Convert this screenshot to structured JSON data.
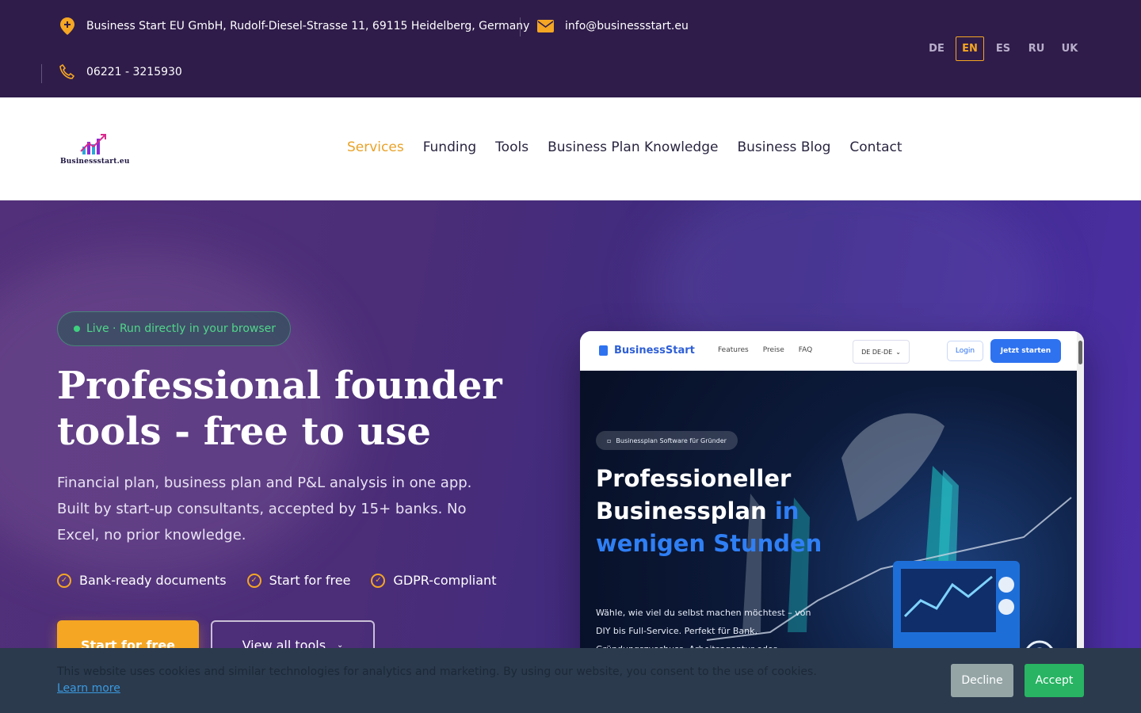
{
  "topbar": {
    "address": "Business Start EU GmbH, Rudolf-Diesel-Strasse 11, 69115 Heidelberg, Germany",
    "email": "info@businessstart.eu",
    "phone": "06221 - 3215930",
    "languages": [
      "DE",
      "EN",
      "ES",
      "RU",
      "UK"
    ],
    "active_language": "EN"
  },
  "header": {
    "logo_text": "Businessstart.eu",
    "nav": [
      "Services",
      "Funding",
      "Tools",
      "Business Plan Knowledge",
      "Business Blog",
      "Contact"
    ],
    "active_nav": "Services"
  },
  "hero": {
    "badge": "Live · Run directly in your browser",
    "title": "Professional founder tools - free to use",
    "subtitle": "Financial plan, business plan and P&L analysis in one app. Built by start-up consultants, accepted by 15+ banks. No Excel, no prior knowledge.",
    "checks": [
      "Bank-ready documents",
      "Start for free",
      "GDPR-compliant"
    ],
    "primary_button": "Start for free",
    "secondary_button": "View all tools"
  },
  "screenshot": {
    "brand": "BusinessStart",
    "links": [
      "Features",
      "Preise",
      "FAQ"
    ],
    "lang": "DE DE-DE",
    "login": "Login",
    "cta": "Jetzt starten",
    "pill": "Businessplan Software für Gründer",
    "headline_white": "Professioneller Businessplan",
    "headline_blue": "in wenigen Stunden",
    "paragraph": "Wähle, wie viel du selbst machen möchtest – von DIY bis Full-Service. Perfekt für Bank, Gründungszuschuss, Arbeitsagentur oder"
  },
  "cookie": {
    "text": "This website uses cookies and similar technologies for analytics and marketing. By using our website, you consent to the use of cookies.",
    "learn_more": "Learn more",
    "decline": "Decline",
    "accept": "Accept"
  },
  "colors": {
    "topbar_bg": "#2f1c4a",
    "accent": "#f5a623",
    "nav_active": "#e9a229",
    "badge_green": "#4fd68a",
    "cookie_bg": "#2b3a4d",
    "accept_green": "#28b463",
    "decline_gray": "#95a5a6"
  }
}
